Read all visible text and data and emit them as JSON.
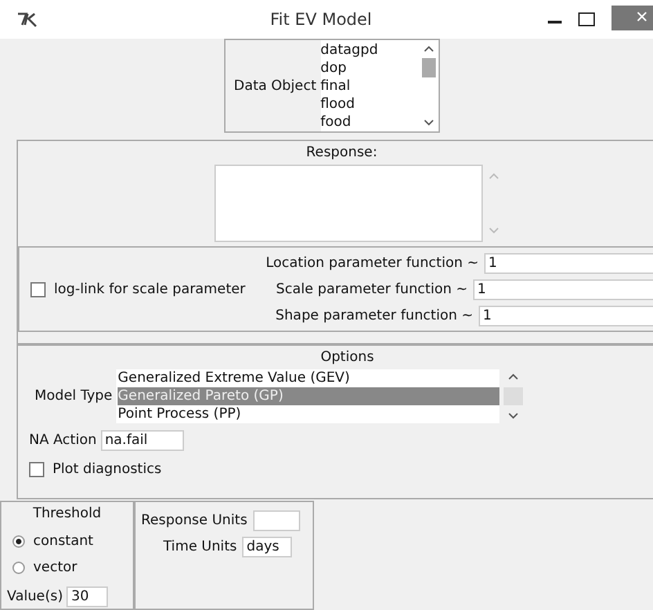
{
  "window": {
    "title": "Fit EV Model"
  },
  "data_object": {
    "label": "Data Object",
    "items": [
      {
        "text": "datagpd",
        "selected": false
      },
      {
        "text": "dop",
        "selected": false
      },
      {
        "text": "final",
        "selected": false
      },
      {
        "text": "flood",
        "selected": false
      },
      {
        "text": "food",
        "selected": false
      }
    ]
  },
  "response": {
    "label": "Response:"
  },
  "parameters": {
    "log_link": {
      "label": "log-link for scale parameter",
      "checked": false
    },
    "fields": [
      {
        "label": "Location parameter function ~",
        "value": "1"
      },
      {
        "label": "Scale parameter function ~",
        "value": "1"
      },
      {
        "label": "Shape parameter function ~",
        "value": "1"
      }
    ]
  },
  "options": {
    "title": "Options",
    "model_type": {
      "label": "Model Type",
      "items": [
        {
          "text": "Generalized Extreme Value (GEV)",
          "selected": false
        },
        {
          "text": "Generalized Pareto (GP)",
          "selected": true
        },
        {
          "text": "Point Process (PP)",
          "selected": false
        }
      ]
    },
    "na_action": {
      "label": "NA Action",
      "value": "na.fail"
    },
    "plot_diagnostics": {
      "label": "Plot diagnostics",
      "checked": false
    }
  },
  "threshold": {
    "title": "Threshold",
    "options": [
      {
        "label": "constant",
        "selected": true
      },
      {
        "label": "vector",
        "selected": false
      }
    ],
    "value_label": "Value(s)",
    "value": "30"
  },
  "units": {
    "response_label": "Response Units",
    "time_label": "Time Units",
    "time_value": "days"
  }
}
